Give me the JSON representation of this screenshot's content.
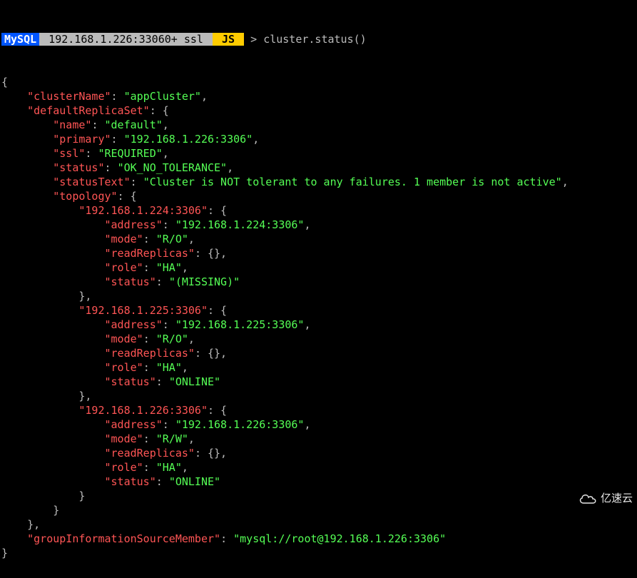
{
  "prompt": {
    "mysql": "MySQL",
    "host": " 192.168.1.226:33060+ ssl ",
    "js": " JS ",
    "command": "cluster.status()"
  },
  "output": {
    "lines": [
      [
        {
          "c": "plain",
          "t": "{"
        }
      ],
      [
        {
          "c": "plain",
          "t": "    "
        },
        {
          "c": "key",
          "t": "\"clusterName\""
        },
        {
          "c": "plain",
          "t": ": "
        },
        {
          "c": "str",
          "t": "\"appCluster\""
        },
        {
          "c": "plain",
          "t": ", "
        }
      ],
      [
        {
          "c": "plain",
          "t": "    "
        },
        {
          "c": "key",
          "t": "\"defaultReplicaSet\""
        },
        {
          "c": "plain",
          "t": ": {"
        }
      ],
      [
        {
          "c": "plain",
          "t": "        "
        },
        {
          "c": "key",
          "t": "\"name\""
        },
        {
          "c": "plain",
          "t": ": "
        },
        {
          "c": "str",
          "t": "\"default\""
        },
        {
          "c": "plain",
          "t": ", "
        }
      ],
      [
        {
          "c": "plain",
          "t": "        "
        },
        {
          "c": "key",
          "t": "\"primary\""
        },
        {
          "c": "plain",
          "t": ": "
        },
        {
          "c": "str",
          "t": "\"192.168.1.226:3306\""
        },
        {
          "c": "plain",
          "t": ", "
        }
      ],
      [
        {
          "c": "plain",
          "t": "        "
        },
        {
          "c": "key",
          "t": "\"ssl\""
        },
        {
          "c": "plain",
          "t": ": "
        },
        {
          "c": "str",
          "t": "\"REQUIRED\""
        },
        {
          "c": "plain",
          "t": ", "
        }
      ],
      [
        {
          "c": "plain",
          "t": "        "
        },
        {
          "c": "key",
          "t": "\"status\""
        },
        {
          "c": "plain",
          "t": ": "
        },
        {
          "c": "str",
          "t": "\"OK_NO_TOLERANCE\""
        },
        {
          "c": "plain",
          "t": ", "
        }
      ],
      [
        {
          "c": "plain",
          "t": "        "
        },
        {
          "c": "key",
          "t": "\"statusText\""
        },
        {
          "c": "plain",
          "t": ": "
        },
        {
          "c": "str",
          "t": "\"Cluster is NOT tolerant to any failures. 1 member is not active\""
        },
        {
          "c": "plain",
          "t": ", "
        }
      ],
      [
        {
          "c": "plain",
          "t": "        "
        },
        {
          "c": "key",
          "t": "\"topology\""
        },
        {
          "c": "plain",
          "t": ": {"
        }
      ],
      [
        {
          "c": "plain",
          "t": "            "
        },
        {
          "c": "key",
          "t": "\"192.168.1.224:3306\""
        },
        {
          "c": "plain",
          "t": ": {"
        }
      ],
      [
        {
          "c": "plain",
          "t": "                "
        },
        {
          "c": "key",
          "t": "\"address\""
        },
        {
          "c": "plain",
          "t": ": "
        },
        {
          "c": "str",
          "t": "\"192.168.1.224:3306\""
        },
        {
          "c": "plain",
          "t": ", "
        }
      ],
      [
        {
          "c": "plain",
          "t": "                "
        },
        {
          "c": "key",
          "t": "\"mode\""
        },
        {
          "c": "plain",
          "t": ": "
        },
        {
          "c": "str",
          "t": "\"R/O\""
        },
        {
          "c": "plain",
          "t": ", "
        }
      ],
      [
        {
          "c": "plain",
          "t": "                "
        },
        {
          "c": "key",
          "t": "\"readReplicas\""
        },
        {
          "c": "plain",
          "t": ": {}, "
        }
      ],
      [
        {
          "c": "plain",
          "t": "                "
        },
        {
          "c": "key",
          "t": "\"role\""
        },
        {
          "c": "plain",
          "t": ": "
        },
        {
          "c": "str",
          "t": "\"HA\""
        },
        {
          "c": "plain",
          "t": ", "
        }
      ],
      [
        {
          "c": "plain",
          "t": "                "
        },
        {
          "c": "key",
          "t": "\"status\""
        },
        {
          "c": "plain",
          "t": ": "
        },
        {
          "c": "str",
          "t": "\"(MISSING)\""
        }
      ],
      [
        {
          "c": "plain",
          "t": "            }, "
        }
      ],
      [
        {
          "c": "plain",
          "t": "            "
        },
        {
          "c": "key",
          "t": "\"192.168.1.225:3306\""
        },
        {
          "c": "plain",
          "t": ": {"
        }
      ],
      [
        {
          "c": "plain",
          "t": "                "
        },
        {
          "c": "key",
          "t": "\"address\""
        },
        {
          "c": "plain",
          "t": ": "
        },
        {
          "c": "str",
          "t": "\"192.168.1.225:3306\""
        },
        {
          "c": "plain",
          "t": ", "
        }
      ],
      [
        {
          "c": "plain",
          "t": "                "
        },
        {
          "c": "key",
          "t": "\"mode\""
        },
        {
          "c": "plain",
          "t": ": "
        },
        {
          "c": "str",
          "t": "\"R/O\""
        },
        {
          "c": "plain",
          "t": ", "
        }
      ],
      [
        {
          "c": "plain",
          "t": "                "
        },
        {
          "c": "key",
          "t": "\"readReplicas\""
        },
        {
          "c": "plain",
          "t": ": {}, "
        }
      ],
      [
        {
          "c": "plain",
          "t": "                "
        },
        {
          "c": "key",
          "t": "\"role\""
        },
        {
          "c": "plain",
          "t": ": "
        },
        {
          "c": "str",
          "t": "\"HA\""
        },
        {
          "c": "plain",
          "t": ", "
        }
      ],
      [
        {
          "c": "plain",
          "t": "                "
        },
        {
          "c": "key",
          "t": "\"status\""
        },
        {
          "c": "plain",
          "t": ": "
        },
        {
          "c": "str",
          "t": "\"ONLINE\""
        }
      ],
      [
        {
          "c": "plain",
          "t": "            }, "
        }
      ],
      [
        {
          "c": "plain",
          "t": "            "
        },
        {
          "c": "key",
          "t": "\"192.168.1.226:3306\""
        },
        {
          "c": "plain",
          "t": ": {"
        }
      ],
      [
        {
          "c": "plain",
          "t": "                "
        },
        {
          "c": "key",
          "t": "\"address\""
        },
        {
          "c": "plain",
          "t": ": "
        },
        {
          "c": "str",
          "t": "\"192.168.1.226:3306\""
        },
        {
          "c": "plain",
          "t": ", "
        }
      ],
      [
        {
          "c": "plain",
          "t": "                "
        },
        {
          "c": "key",
          "t": "\"mode\""
        },
        {
          "c": "plain",
          "t": ": "
        },
        {
          "c": "str",
          "t": "\"R/W\""
        },
        {
          "c": "plain",
          "t": ", "
        }
      ],
      [
        {
          "c": "plain",
          "t": "                "
        },
        {
          "c": "key",
          "t": "\"readReplicas\""
        },
        {
          "c": "plain",
          "t": ": {}, "
        }
      ],
      [
        {
          "c": "plain",
          "t": "                "
        },
        {
          "c": "key",
          "t": "\"role\""
        },
        {
          "c": "plain",
          "t": ": "
        },
        {
          "c": "str",
          "t": "\"HA\""
        },
        {
          "c": "plain",
          "t": ", "
        }
      ],
      [
        {
          "c": "plain",
          "t": "                "
        },
        {
          "c": "key",
          "t": "\"status\""
        },
        {
          "c": "plain",
          "t": ": "
        },
        {
          "c": "str",
          "t": "\"ONLINE\""
        }
      ],
      [
        {
          "c": "plain",
          "t": "            }"
        }
      ],
      [
        {
          "c": "plain",
          "t": "        }"
        }
      ],
      [
        {
          "c": "plain",
          "t": "    }, "
        }
      ],
      [
        {
          "c": "plain",
          "t": "    "
        },
        {
          "c": "key",
          "t": "\"groupInformationSourceMember\""
        },
        {
          "c": "plain",
          "t": ": "
        },
        {
          "c": "str",
          "t": "\"mysql://root@192.168.1.226:3306\""
        }
      ],
      [
        {
          "c": "plain",
          "t": "}"
        }
      ]
    ]
  },
  "watermark": "亿速云"
}
